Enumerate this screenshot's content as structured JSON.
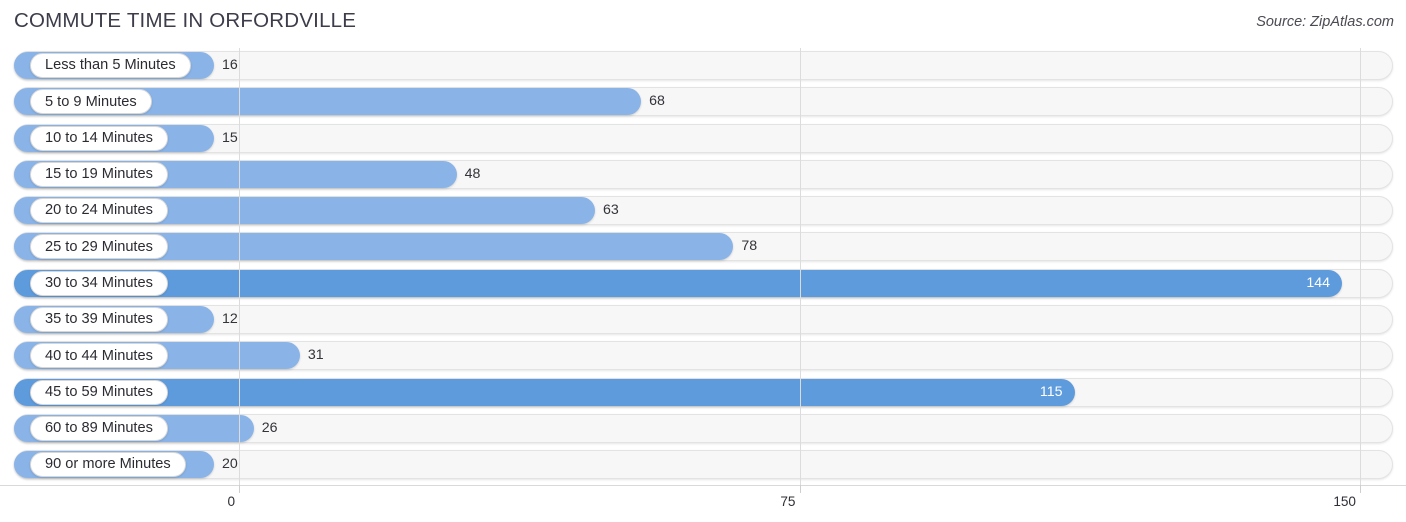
{
  "header": {
    "title": "COMMUTE TIME IN ORFORDVILLE",
    "source": "Source: ZipAtlas.com"
  },
  "colors": {
    "bar": "#8ab4e8",
    "bar_highlight": "#5e9bdd",
    "track": "#f7f7f7",
    "gridline": "#dcdcdc",
    "text": "#33333a"
  },
  "chart_data": {
    "type": "bar",
    "orientation": "horizontal",
    "title": "COMMUTE TIME IN ORFORDVILLE",
    "xlabel": "",
    "ylabel": "",
    "xlim": [
      0,
      150
    ],
    "grid": true,
    "legend": null,
    "source": "Source: ZipAtlas.com",
    "axis_ticks": [
      "0",
      "75",
      "150"
    ],
    "axis_tick_values": [
      0,
      75,
      150
    ],
    "categories": [
      "Less than 5 Minutes",
      "5 to 9 Minutes",
      "10 to 14 Minutes",
      "15 to 19 Minutes",
      "20 to 24 Minutes",
      "25 to 29 Minutes",
      "30 to 34 Minutes",
      "35 to 39 Minutes",
      "40 to 44 Minutes",
      "45 to 59 Minutes",
      "60 to 89 Minutes",
      "90 or more Minutes"
    ],
    "values": [
      16,
      68,
      15,
      48,
      63,
      78,
      144,
      12,
      31,
      115,
      26,
      20
    ],
    "value_labels": [
      "16",
      "68",
      "15",
      "48",
      "63",
      "78",
      "144",
      "12",
      "31",
      "115",
      "26",
      "20"
    ],
    "highlighted": [
      false,
      false,
      false,
      false,
      false,
      false,
      true,
      false,
      false,
      true,
      false,
      false
    ]
  }
}
